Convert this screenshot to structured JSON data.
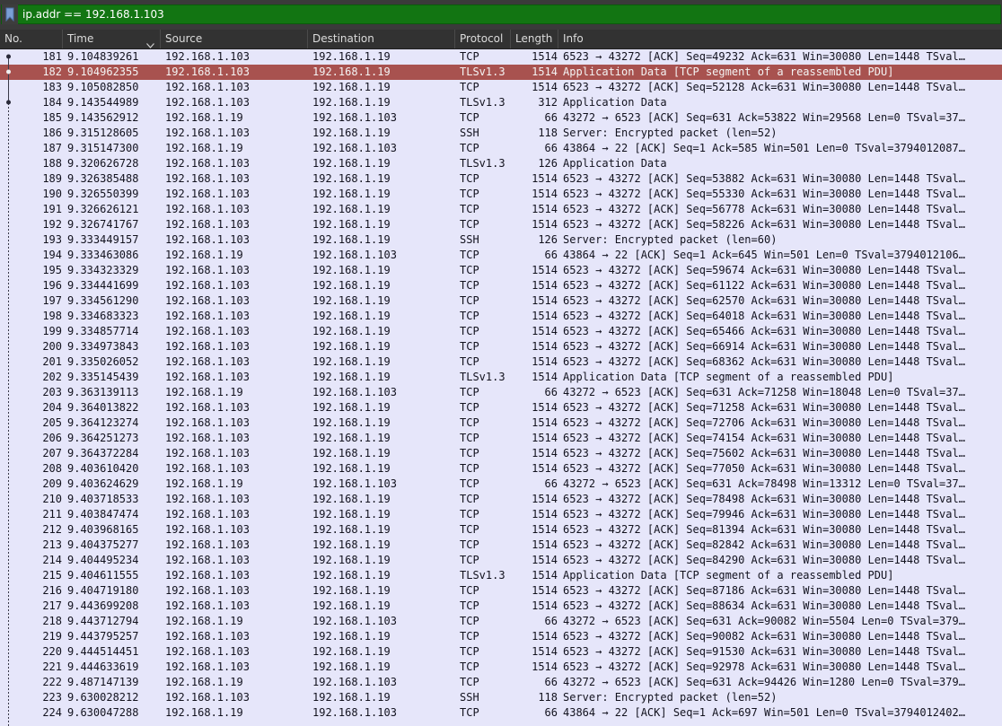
{
  "filter": {
    "value": "ip.addr == 192.168.1.103",
    "icon": "bookmark-icon"
  },
  "columns": {
    "no": "No.",
    "time": "Time",
    "source": "Source",
    "destination": "Destination",
    "protocol": "Protocol",
    "length": "Length",
    "info": "Info"
  },
  "colors": {
    "filter_valid_bg": "#127512",
    "row_bg": "#e6e6fa",
    "selected_bg": "#a8524f"
  },
  "selected_packet": "182",
  "packets": [
    {
      "no": "181",
      "time": "9.104839261",
      "src": "192.168.1.103",
      "dst": "192.168.1.19",
      "proto": "TCP",
      "len": "1514",
      "info": "6523 → 43272 [ACK] Seq=49232 Ack=631 Win=30080 Len=1448 TSval…"
    },
    {
      "no": "182",
      "time": "9.104962355",
      "src": "192.168.1.103",
      "dst": "192.168.1.19",
      "proto": "TLSv1.3",
      "len": "1514",
      "info": "Application Data [TCP segment of a reassembled PDU]"
    },
    {
      "no": "183",
      "time": "9.105082850",
      "src": "192.168.1.103",
      "dst": "192.168.1.19",
      "proto": "TCP",
      "len": "1514",
      "info": "6523 → 43272 [ACK] Seq=52128 Ack=631 Win=30080 Len=1448 TSval…"
    },
    {
      "no": "184",
      "time": "9.143544989",
      "src": "192.168.1.103",
      "dst": "192.168.1.19",
      "proto": "TLSv1.3",
      "len": "312",
      "info": "Application Data"
    },
    {
      "no": "185",
      "time": "9.143562912",
      "src": "192.168.1.19",
      "dst": "192.168.1.103",
      "proto": "TCP",
      "len": "66",
      "info": "43272 → 6523 [ACK] Seq=631 Ack=53822 Win=29568 Len=0 TSval=37…"
    },
    {
      "no": "186",
      "time": "9.315128605",
      "src": "192.168.1.103",
      "dst": "192.168.1.19",
      "proto": "SSH",
      "len": "118",
      "info": "Server: Encrypted packet (len=52)"
    },
    {
      "no": "187",
      "time": "9.315147300",
      "src": "192.168.1.19",
      "dst": "192.168.1.103",
      "proto": "TCP",
      "len": "66",
      "info": "43864 → 22 [ACK] Seq=1 Ack=585 Win=501 Len=0 TSval=3794012087…"
    },
    {
      "no": "188",
      "time": "9.320626728",
      "src": "192.168.1.103",
      "dst": "192.168.1.19",
      "proto": "TLSv1.3",
      "len": "126",
      "info": "Application Data"
    },
    {
      "no": "189",
      "time": "9.326385488",
      "src": "192.168.1.103",
      "dst": "192.168.1.19",
      "proto": "TCP",
      "len": "1514",
      "info": "6523 → 43272 [ACK] Seq=53882 Ack=631 Win=30080 Len=1448 TSval…"
    },
    {
      "no": "190",
      "time": "9.326550399",
      "src": "192.168.1.103",
      "dst": "192.168.1.19",
      "proto": "TCP",
      "len": "1514",
      "info": "6523 → 43272 [ACK] Seq=55330 Ack=631 Win=30080 Len=1448 TSval…"
    },
    {
      "no": "191",
      "time": "9.326626121",
      "src": "192.168.1.103",
      "dst": "192.168.1.19",
      "proto": "TCP",
      "len": "1514",
      "info": "6523 → 43272 [ACK] Seq=56778 Ack=631 Win=30080 Len=1448 TSval…"
    },
    {
      "no": "192",
      "time": "9.326741767",
      "src": "192.168.1.103",
      "dst": "192.168.1.19",
      "proto": "TCP",
      "len": "1514",
      "info": "6523 → 43272 [ACK] Seq=58226 Ack=631 Win=30080 Len=1448 TSval…"
    },
    {
      "no": "193",
      "time": "9.333449157",
      "src": "192.168.1.103",
      "dst": "192.168.1.19",
      "proto": "SSH",
      "len": "126",
      "info": "Server: Encrypted packet (len=60)"
    },
    {
      "no": "194",
      "time": "9.333463086",
      "src": "192.168.1.19",
      "dst": "192.168.1.103",
      "proto": "TCP",
      "len": "66",
      "info": "43864 → 22 [ACK] Seq=1 Ack=645 Win=501 Len=0 TSval=3794012106…"
    },
    {
      "no": "195",
      "time": "9.334323329",
      "src": "192.168.1.103",
      "dst": "192.168.1.19",
      "proto": "TCP",
      "len": "1514",
      "info": "6523 → 43272 [ACK] Seq=59674 Ack=631 Win=30080 Len=1448 TSval…"
    },
    {
      "no": "196",
      "time": "9.334441699",
      "src": "192.168.1.103",
      "dst": "192.168.1.19",
      "proto": "TCP",
      "len": "1514",
      "info": "6523 → 43272 [ACK] Seq=61122 Ack=631 Win=30080 Len=1448 TSval…"
    },
    {
      "no": "197",
      "time": "9.334561290",
      "src": "192.168.1.103",
      "dst": "192.168.1.19",
      "proto": "TCP",
      "len": "1514",
      "info": "6523 → 43272 [ACK] Seq=62570 Ack=631 Win=30080 Len=1448 TSval…"
    },
    {
      "no": "198",
      "time": "9.334683323",
      "src": "192.168.1.103",
      "dst": "192.168.1.19",
      "proto": "TCP",
      "len": "1514",
      "info": "6523 → 43272 [ACK] Seq=64018 Ack=631 Win=30080 Len=1448 TSval…"
    },
    {
      "no": "199",
      "time": "9.334857714",
      "src": "192.168.1.103",
      "dst": "192.168.1.19",
      "proto": "TCP",
      "len": "1514",
      "info": "6523 → 43272 [ACK] Seq=65466 Ack=631 Win=30080 Len=1448 TSval…"
    },
    {
      "no": "200",
      "time": "9.334973843",
      "src": "192.168.1.103",
      "dst": "192.168.1.19",
      "proto": "TCP",
      "len": "1514",
      "info": "6523 → 43272 [ACK] Seq=66914 Ack=631 Win=30080 Len=1448 TSval…"
    },
    {
      "no": "201",
      "time": "9.335026052",
      "src": "192.168.1.103",
      "dst": "192.168.1.19",
      "proto": "TCP",
      "len": "1514",
      "info": "6523 → 43272 [ACK] Seq=68362 Ack=631 Win=30080 Len=1448 TSval…"
    },
    {
      "no": "202",
      "time": "9.335145439",
      "src": "192.168.1.103",
      "dst": "192.168.1.19",
      "proto": "TLSv1.3",
      "len": "1514",
      "info": "Application Data [TCP segment of a reassembled PDU]"
    },
    {
      "no": "203",
      "time": "9.363139113",
      "src": "192.168.1.19",
      "dst": "192.168.1.103",
      "proto": "TCP",
      "len": "66",
      "info": "43272 → 6523 [ACK] Seq=631 Ack=71258 Win=18048 Len=0 TSval=37…"
    },
    {
      "no": "204",
      "time": "9.364013822",
      "src": "192.168.1.103",
      "dst": "192.168.1.19",
      "proto": "TCP",
      "len": "1514",
      "info": "6523 → 43272 [ACK] Seq=71258 Ack=631 Win=30080 Len=1448 TSval…"
    },
    {
      "no": "205",
      "time": "9.364123274",
      "src": "192.168.1.103",
      "dst": "192.168.1.19",
      "proto": "TCP",
      "len": "1514",
      "info": "6523 → 43272 [ACK] Seq=72706 Ack=631 Win=30080 Len=1448 TSval…"
    },
    {
      "no": "206",
      "time": "9.364251273",
      "src": "192.168.1.103",
      "dst": "192.168.1.19",
      "proto": "TCP",
      "len": "1514",
      "info": "6523 → 43272 [ACK] Seq=74154 Ack=631 Win=30080 Len=1448 TSval…"
    },
    {
      "no": "207",
      "time": "9.364372284",
      "src": "192.168.1.103",
      "dst": "192.168.1.19",
      "proto": "TCP",
      "len": "1514",
      "info": "6523 → 43272 [ACK] Seq=75602 Ack=631 Win=30080 Len=1448 TSval…"
    },
    {
      "no": "208",
      "time": "9.403610420",
      "src": "192.168.1.103",
      "dst": "192.168.1.19",
      "proto": "TCP",
      "len": "1514",
      "info": "6523 → 43272 [ACK] Seq=77050 Ack=631 Win=30080 Len=1448 TSval…"
    },
    {
      "no": "209",
      "time": "9.403624629",
      "src": "192.168.1.19",
      "dst": "192.168.1.103",
      "proto": "TCP",
      "len": "66",
      "info": "43272 → 6523 [ACK] Seq=631 Ack=78498 Win=13312 Len=0 TSval=37…"
    },
    {
      "no": "210",
      "time": "9.403718533",
      "src": "192.168.1.103",
      "dst": "192.168.1.19",
      "proto": "TCP",
      "len": "1514",
      "info": "6523 → 43272 [ACK] Seq=78498 Ack=631 Win=30080 Len=1448 TSval…"
    },
    {
      "no": "211",
      "time": "9.403847474",
      "src": "192.168.1.103",
      "dst": "192.168.1.19",
      "proto": "TCP",
      "len": "1514",
      "info": "6523 → 43272 [ACK] Seq=79946 Ack=631 Win=30080 Len=1448 TSval…"
    },
    {
      "no": "212",
      "time": "9.403968165",
      "src": "192.168.1.103",
      "dst": "192.168.1.19",
      "proto": "TCP",
      "len": "1514",
      "info": "6523 → 43272 [ACK] Seq=81394 Ack=631 Win=30080 Len=1448 TSval…"
    },
    {
      "no": "213",
      "time": "9.404375277",
      "src": "192.168.1.103",
      "dst": "192.168.1.19",
      "proto": "TCP",
      "len": "1514",
      "info": "6523 → 43272 [ACK] Seq=82842 Ack=631 Win=30080 Len=1448 TSval…"
    },
    {
      "no": "214",
      "time": "9.404495234",
      "src": "192.168.1.103",
      "dst": "192.168.1.19",
      "proto": "TCP",
      "len": "1514",
      "info": "6523 → 43272 [ACK] Seq=84290 Ack=631 Win=30080 Len=1448 TSval…"
    },
    {
      "no": "215",
      "time": "9.404611555",
      "src": "192.168.1.103",
      "dst": "192.168.1.19",
      "proto": "TLSv1.3",
      "len": "1514",
      "info": "Application Data [TCP segment of a reassembled PDU]"
    },
    {
      "no": "216",
      "time": "9.404719180",
      "src": "192.168.1.103",
      "dst": "192.168.1.19",
      "proto": "TCP",
      "len": "1514",
      "info": "6523 → 43272 [ACK] Seq=87186 Ack=631 Win=30080 Len=1448 TSval…"
    },
    {
      "no": "217",
      "time": "9.443699208",
      "src": "192.168.1.103",
      "dst": "192.168.1.19",
      "proto": "TCP",
      "len": "1514",
      "info": "6523 → 43272 [ACK] Seq=88634 Ack=631 Win=30080 Len=1448 TSval…"
    },
    {
      "no": "218",
      "time": "9.443712794",
      "src": "192.168.1.19",
      "dst": "192.168.1.103",
      "proto": "TCP",
      "len": "66",
      "info": "43272 → 6523 [ACK] Seq=631 Ack=90082 Win=5504 Len=0 TSval=379…"
    },
    {
      "no": "219",
      "time": "9.443795257",
      "src": "192.168.1.103",
      "dst": "192.168.1.19",
      "proto": "TCP",
      "len": "1514",
      "info": "6523 → 43272 [ACK] Seq=90082 Ack=631 Win=30080 Len=1448 TSval…"
    },
    {
      "no": "220",
      "time": "9.444514451",
      "src": "192.168.1.103",
      "dst": "192.168.1.19",
      "proto": "TCP",
      "len": "1514",
      "info": "6523 → 43272 [ACK] Seq=91530 Ack=631 Win=30080 Len=1448 TSval…"
    },
    {
      "no": "221",
      "time": "9.444633619",
      "src": "192.168.1.103",
      "dst": "192.168.1.19",
      "proto": "TCP",
      "len": "1514",
      "info": "6523 → 43272 [ACK] Seq=92978 Ack=631 Win=30080 Len=1448 TSval…"
    },
    {
      "no": "222",
      "time": "9.487147139",
      "src": "192.168.1.19",
      "dst": "192.168.1.103",
      "proto": "TCP",
      "len": "66",
      "info": "43272 → 6523 [ACK] Seq=631 Ack=94426 Win=1280 Len=0 TSval=379…"
    },
    {
      "no": "223",
      "time": "9.630028212",
      "src": "192.168.1.103",
      "dst": "192.168.1.19",
      "proto": "SSH",
      "len": "118",
      "info": "Server: Encrypted packet (len=52)"
    },
    {
      "no": "224",
      "time": "9.630047288",
      "src": "192.168.1.19",
      "dst": "192.168.1.103",
      "proto": "TCP",
      "len": "66",
      "info": "43864 → 22 [ACK] Seq=1 Ack=697 Win=501 Len=0 TSval=3794012402…"
    }
  ]
}
